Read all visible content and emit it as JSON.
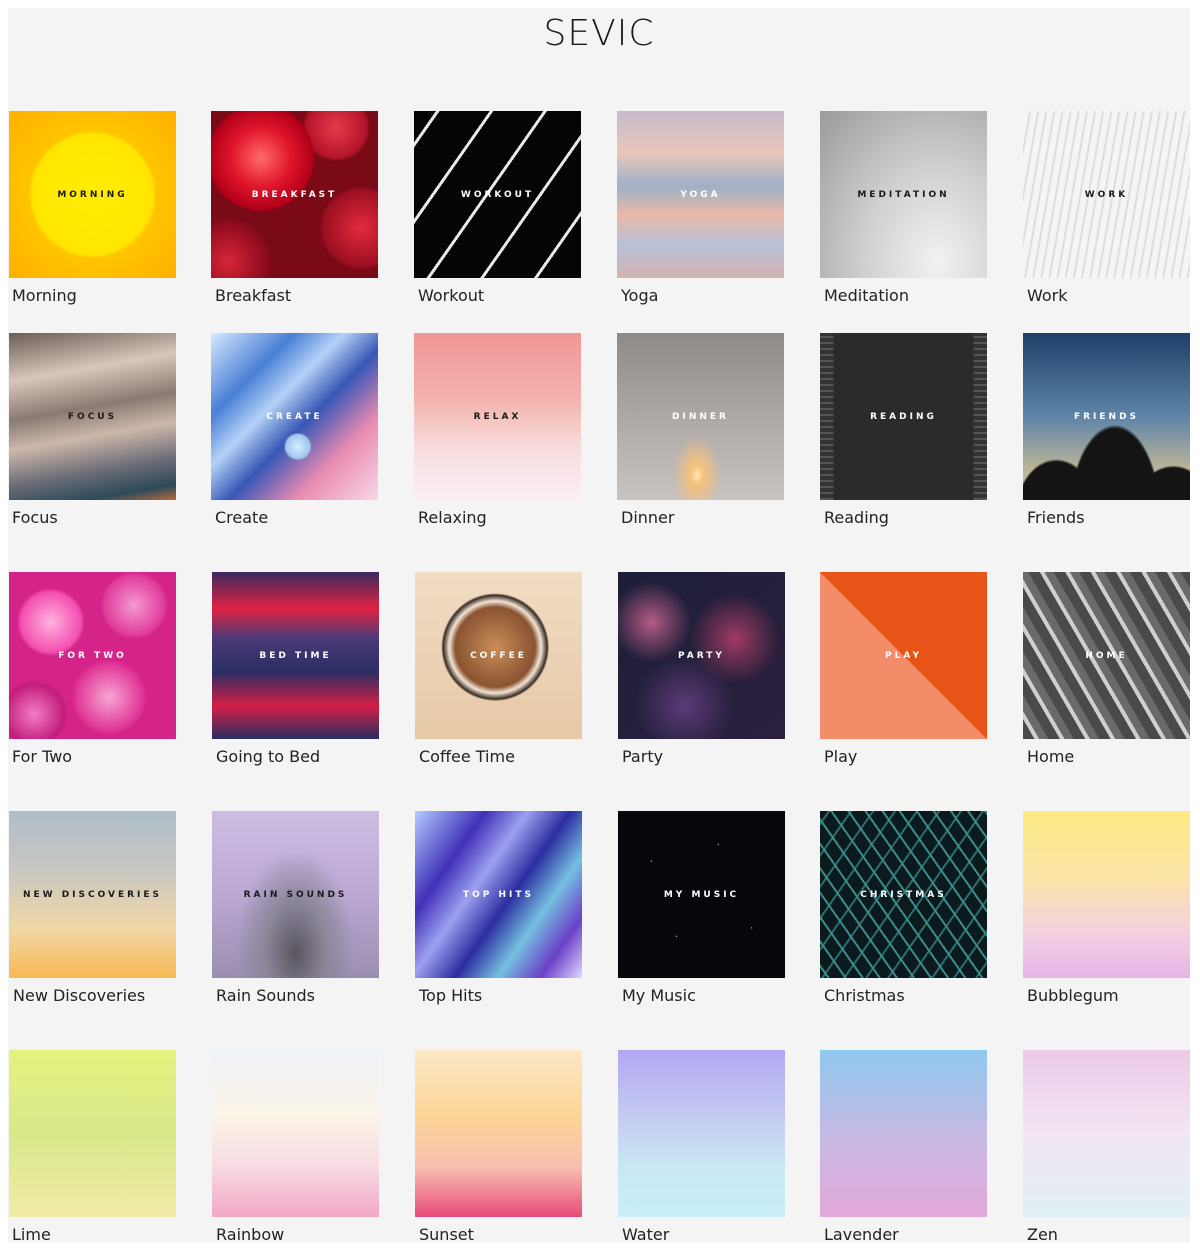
{
  "logo": "SEVIC",
  "tiles": [
    {
      "tag": "MORNING",
      "title": "Morning"
    },
    {
      "tag": "BREAKFAST",
      "title": "Breakfast"
    },
    {
      "tag": "WORKOUT",
      "title": "Workout"
    },
    {
      "tag": "YOGA",
      "title": "Yoga"
    },
    {
      "tag": "MEDITATION",
      "title": "Meditation"
    },
    {
      "tag": "WORK",
      "title": "Work"
    },
    {
      "tag": "FOCUS",
      "title": "Focus"
    },
    {
      "tag": "CREATE",
      "title": "Create"
    },
    {
      "tag": "RELAX",
      "title": "Relaxing"
    },
    {
      "tag": "DINNER",
      "title": "Dinner"
    },
    {
      "tag": "READING",
      "title": "Reading"
    },
    {
      "tag": "FRIENDS",
      "title": "Friends"
    },
    {
      "tag": "FOR TWO",
      "title": "For Two"
    },
    {
      "tag": "BED TIME",
      "title": "Going to Bed"
    },
    {
      "tag": "COFFEE",
      "title": "Coffee Time"
    },
    {
      "tag": "PARTY",
      "title": "Party"
    },
    {
      "tag": "PLAY",
      "title": "Play"
    },
    {
      "tag": "HOME",
      "title": "Home"
    },
    {
      "tag": "NEW DISCOVERIES",
      "title": "New Discoveries"
    },
    {
      "tag": "RAIN SOUNDS",
      "title": "Rain Sounds"
    },
    {
      "tag": "TOP HITS",
      "title": "Top Hits"
    },
    {
      "tag": "MY MUSIC",
      "title": "My Music"
    },
    {
      "tag": "CHRISTMAS",
      "title": "Christmas"
    },
    {
      "tag": "",
      "title": "Bubblegum"
    },
    {
      "tag": "",
      "title": "Lime"
    },
    {
      "tag": "",
      "title": "Rainbow"
    },
    {
      "tag": "",
      "title": "Sunset"
    },
    {
      "tag": "",
      "title": "Water"
    },
    {
      "tag": "",
      "title": "Lavender"
    },
    {
      "tag": "",
      "title": "Zen"
    }
  ]
}
